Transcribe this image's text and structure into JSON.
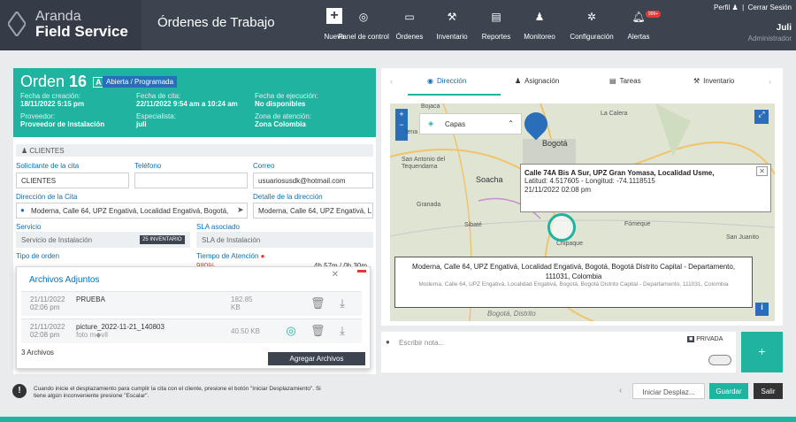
{
  "brand": {
    "line1": "Aranda",
    "line2": "Field Service"
  },
  "header": {
    "title": "Órdenes de Trabajo"
  },
  "nav": [
    {
      "id": "nueva",
      "label": "Nueva",
      "icon": "plus-icon"
    },
    {
      "id": "panel",
      "label": "Panel de control",
      "icon": "dashboard-icon"
    },
    {
      "id": "ordenes",
      "label": "Órdenes",
      "icon": "orders-icon"
    },
    {
      "id": "inventario",
      "label": "Inventario",
      "icon": "inventory-icon"
    },
    {
      "id": "reportes",
      "label": "Reportes",
      "icon": "reports-icon"
    },
    {
      "id": "monitoreo",
      "label": "Monitoreo",
      "icon": "monitor-icon"
    },
    {
      "id": "configuracion",
      "label": "Configuración",
      "icon": "gear-icon"
    },
    {
      "id": "alertas",
      "label": "Alertas",
      "icon": "bell-icon",
      "badge": "999+"
    }
  ],
  "user": {
    "profile": "Perfil",
    "logout": "Cerrar Sesión",
    "name": "Juli",
    "role": "Administrador"
  },
  "order": {
    "prefix": "Orden",
    "number": "16",
    "letter": "A",
    "status": "Abierta / Programada",
    "created_label": "Fecha de creación:",
    "created": "18/11/2022 5:15 pm",
    "appt_label": "Fecha de cita:",
    "appt": "22/11/2022 9:54 am a 10:24 am",
    "exec_label": "Fecha de ejecución:",
    "exec": "No disponibles",
    "provider_label": "Proveedor:",
    "provider": "Proveedor de Instalación",
    "specialist_label": "Especialista:",
    "specialist": "juli",
    "zone_label": "Zona de atención:",
    "zone": "Zona Colombia"
  },
  "clients": {
    "section": "CLIENTES",
    "requester_label": "Solicitante de la cita",
    "requester": "CLIENTES",
    "phone_label": "Teléfono",
    "phone": "",
    "email_label": "Correo",
    "email": "usuariosusdk@hotmail.com",
    "address_label": "Dirección de la Cita",
    "address": "Moderna, Calle 64, UPZ Engativá, Localidad Engativá, Bogotá,",
    "detail_label": "Detalle de la dirección",
    "detail": "Moderna, Calle 64, UPZ Engativá, L",
    "service_label": "Servicio",
    "service": "Servicio de Instalación",
    "service_tag": "25 INVENTARIO",
    "sla_label": "SLA asociado",
    "sla": "SLA de Instalación",
    "type_label": "Tipo de orden",
    "time_label": "Tiempo de Atención",
    "time_pct": "980%",
    "time_val": "4h 57m / 0h 30m"
  },
  "attachments": {
    "title": "Archivos Adjuntos",
    "rows": [
      {
        "date": "21/11/2022",
        "time": "02:06 pm",
        "name": "PRUEBA",
        "sub": "",
        "size": "182.85",
        "unit": "KB"
      },
      {
        "date": "21/11/2022",
        "time": "02:08 pm",
        "name": "picture_2022-11-21_140803",
        "sub": "foto m◆vil",
        "size": "40.50 KB",
        "unit": ""
      }
    ],
    "count": "3 Archivos",
    "add_button": "Agregar Archivos"
  },
  "tabs": [
    {
      "label": "Dirección",
      "icon": "compass-icon",
      "active": true
    },
    {
      "label": "Asignación",
      "icon": "person-icon",
      "active": false
    },
    {
      "label": "Tareas",
      "icon": "tasks-icon",
      "active": false
    },
    {
      "label": "Inventario",
      "icon": "tools-icon",
      "active": false
    }
  ],
  "map": {
    "layers": "Capas",
    "places": [
      "Bojacá",
      "La Calera",
      "Tena",
      "Bogotá",
      "San Antonio del Tequendama",
      "Soacha",
      "Granada",
      "Sibaté",
      "Chipaque",
      "Fómeque",
      "San Juanito",
      "Bogotá, Distrito"
    ],
    "popup1": {
      "title": "Calle 74A Bis A Sur, UPZ Gran Yomasa, Localidad Usme,",
      "coords": "Latitud: 4.517605 - Longitud: -74.1118515",
      "date": "21/11/2022 02:08 pm"
    },
    "popup2": {
      "main": "Moderna, Calle 64, UPZ Engativá, Localidad Engativá, Bogotá, Bogotá Distrito Capital - Departamento, 111031, Colombia",
      "sub": "Moderna, Calle 64, UPZ Engativá, Localidad Engativá, Bogotá, Bogotá Distrito Capital - Departamento, 111031, Colombia"
    }
  },
  "note": {
    "placeholder": "Escribir nota...",
    "private": "PRIVADA"
  },
  "footer": {
    "message": "Cuando inicie el desplazamiento para cumplir la cita con el cliente, presione el botón \"Iniciar Desplazamiento\". Si tiene algún inconveniente presione \"Escalar\".",
    "start": "Iniciar Desplaz...",
    "save": "Guardar",
    "exit": "Salir"
  }
}
